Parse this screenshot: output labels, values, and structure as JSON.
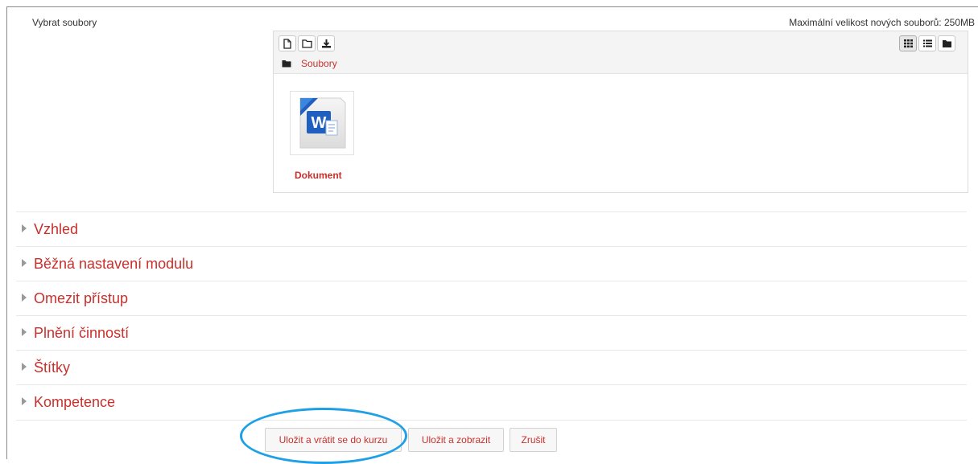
{
  "file_field": {
    "label": "Vybrat soubory",
    "max_size": "Maximální velikost nových souborů: 250MB"
  },
  "filepicker": {
    "toolbar_left": [
      {
        "icon": "new-file-icon"
      },
      {
        "icon": "new-folder-icon"
      },
      {
        "icon": "download-icon"
      }
    ],
    "toolbar_right": [
      {
        "icon": "grid-view-icon",
        "active": true
      },
      {
        "icon": "list-view-icon"
      },
      {
        "icon": "tree-view-icon"
      }
    ],
    "path": "Soubory",
    "file": {
      "name": "Dokument",
      "icon": "word-document-icon"
    }
  },
  "sections": [
    {
      "label": "Vzhled"
    },
    {
      "label": "Běžná nastavení modulu"
    },
    {
      "label": "Omezit přístup"
    },
    {
      "label": "Plnění činností"
    },
    {
      "label": "Štítky"
    },
    {
      "label": "Kompetence"
    }
  ],
  "buttons": {
    "save_return": "Uložit a vrátit se do kurzu",
    "save_display": "Uložit a zobrazit",
    "cancel": "Zrušit"
  },
  "colors": {
    "link": "#c9302c",
    "highlight": "#1fa0e6"
  }
}
